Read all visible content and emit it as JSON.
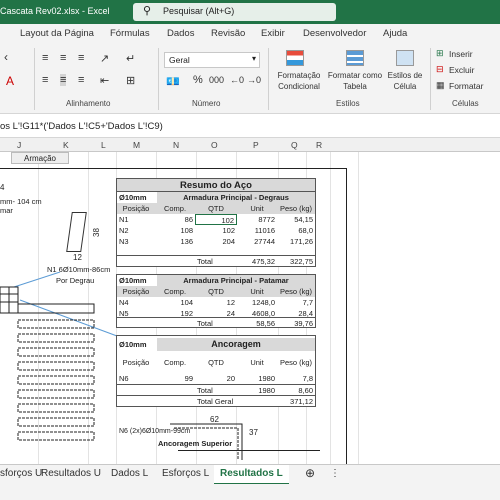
{
  "title_bar": {
    "document": "Cascata Rev02.xlsx  -  Excel",
    "search_placeholder": "Pesquisar (Alt+G)"
  },
  "menu": [
    "Layout da Página",
    "Fórmulas",
    "Dados",
    "Revisão",
    "Exibir",
    "Desenvolvedor",
    "Ajuda"
  ],
  "ribbon": {
    "number_format": "Geral",
    "percent": "%",
    "thousands": "000",
    "conditional_formatting": "Formatação Condicional",
    "format_as_table": "Formatar como Tabela",
    "cell_styles": "Estilos de Célula",
    "insert": "Inserir",
    "delete": "Excluir",
    "format": "Formatar",
    "groups": {
      "alignment": "Alinhamento",
      "number": "Número",
      "styles": "Estilos",
      "cells": "Células"
    }
  },
  "formula": "os L'!G11*('Dados L'!C5+'Dados L'!C9)",
  "columns": [
    "J",
    "K",
    "L",
    "M",
    "N",
    "O",
    "P",
    "Q",
    "R"
  ],
  "sheet": {
    "armacao_label": "Armação",
    "left_texts": [
      "mm- 104 cm",
      "mar"
    ],
    "dim_38": "38",
    "dim_12": "12",
    "n1_label": "N1 6Ø10mm-86cm",
    "por_degrau": "Por Degrau",
    "dim_62": "62",
    "dim_37": "37",
    "n6_label": "N6 (2x)6Ø10mm-99cm",
    "anc_sup": "Ancoragem Superior"
  },
  "resumo": {
    "title": "Resumo do Aço",
    "t1": {
      "diam": "Ø10mm",
      "name": "Armadura Principal - Degraus",
      "headers": [
        "Posição",
        "Comp.",
        "QTD",
        "Unit",
        "Peso (kg)"
      ],
      "rows": [
        [
          "N1",
          "86",
          "102",
          "8772",
          "54,15"
        ],
        [
          "N2",
          "108",
          "102",
          "11016",
          "68,0"
        ],
        [
          "N3",
          "136",
          "204",
          "27744",
          "171,26"
        ]
      ],
      "total_label": "Total",
      "total_unit": "475,32",
      "total_peso": "322,75"
    },
    "t2": {
      "diam": "Ø10mm",
      "name": "Armadura Principal - Patamar",
      "headers": [
        "Posição",
        "Comp.",
        "QTD",
        "Unit",
        "Peso (kg)"
      ],
      "rows": [
        [
          "N4",
          "104",
          "12",
          "1248,0",
          "7,7"
        ],
        [
          "N5",
          "192",
          "24",
          "4608,0",
          "28,4"
        ]
      ],
      "total_label": "Total",
      "total_unit": "58,56",
      "total_peso": "39,76"
    },
    "t3": {
      "diam": "Ø10mm",
      "name": "Ancoragem",
      "headers": [
        "Posição",
        "Comp.",
        "QTD",
        "Unit",
        "Peso (kg)"
      ],
      "rows": [
        [
          "N6",
          "99",
          "20",
          "1980",
          "7,8"
        ]
      ],
      "total_label": "Total",
      "total_unit": "1980",
      "total_peso": "8,60",
      "total_geral_label": "Total Geral",
      "total_geral": "371,12"
    }
  },
  "tabs": [
    "sforços U",
    "Resultados U",
    "Dados L",
    "Esforços L",
    "Resultados L"
  ],
  "active_tab": "Resultados L",
  "colors": {
    "excel_green": "#217346"
  }
}
